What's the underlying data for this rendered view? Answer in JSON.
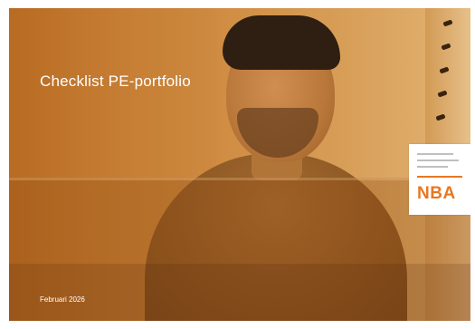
{
  "document": {
    "title": "Checklist PE-portfolio",
    "date": "Februari 2026",
    "logo_text": "NBA"
  },
  "colors": {
    "accent": "#e87722",
    "tint": "#c87c2d"
  }
}
